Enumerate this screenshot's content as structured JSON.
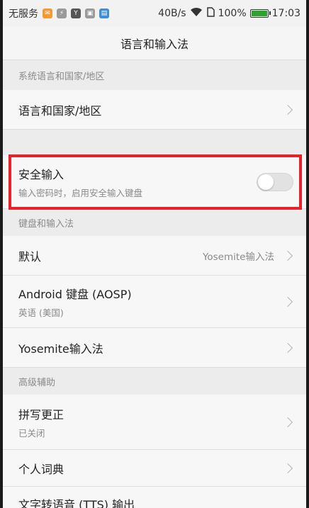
{
  "status_bar": {
    "carrier": "无服务",
    "speed": "40B/s",
    "battery_percent": "100%",
    "battery_level": 1.0,
    "time": "17:03"
  },
  "header": {
    "title": "语言和输入法"
  },
  "sections": {
    "system_lang": {
      "header": "系统语言和国家/地区",
      "item_title": "语言和国家/地区"
    },
    "secure_input": {
      "title": "安全输入",
      "subtitle": "输入密码时，启用安全输入键盘",
      "enabled": false
    },
    "keyboard": {
      "header": "键盘和输入法",
      "default_title": "默认",
      "default_value": "Yosemite输入法",
      "aosp_title": "Android 键盘 (AOSP)",
      "aosp_sub": "英语 (美国)",
      "yosemite_title": "Yosemite输入法"
    },
    "advanced": {
      "header": "高级辅助",
      "spell_title": "拼写更正",
      "spell_sub": "已关闭",
      "dict_title": "个人词典",
      "tts_title": "文字转语音 (TTS) 输出"
    }
  },
  "colors": {
    "highlight": "#e8222a",
    "background": "#f2f2f2"
  }
}
